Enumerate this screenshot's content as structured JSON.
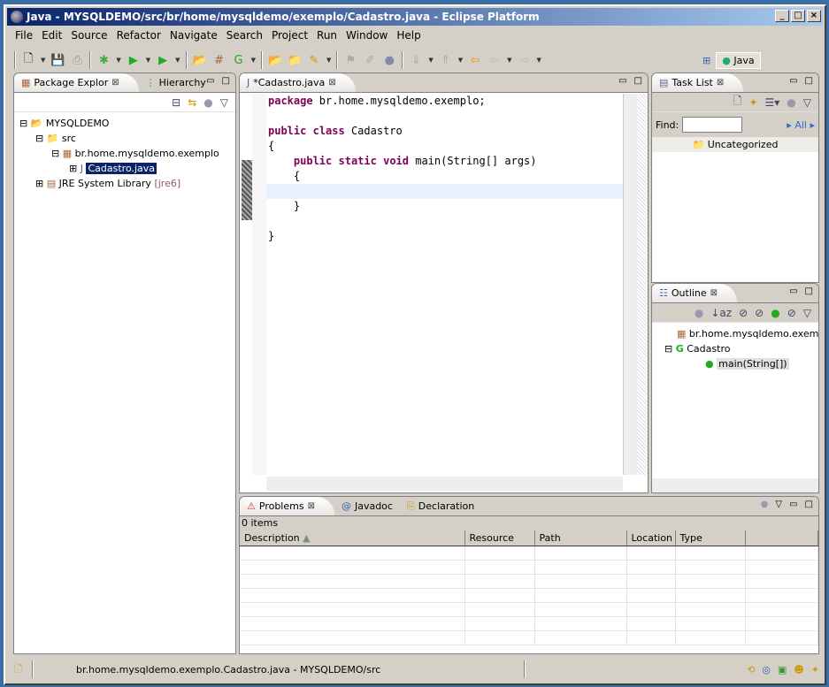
{
  "window": {
    "title": "Java - MYSQLDEMO/src/br/home/mysqldemo/exemplo/Cadastro.java - Eclipse Platform"
  },
  "menu": [
    "File",
    "Edit",
    "Source",
    "Refactor",
    "Navigate",
    "Search",
    "Project",
    "Run",
    "Window",
    "Help"
  ],
  "perspective": {
    "label": "Java"
  },
  "package_explorer": {
    "tabs": [
      "Package Explor",
      "Hierarchy"
    ],
    "tree": {
      "project": "MYSQLDEMO",
      "src": "src",
      "package": "br.home.mysqldemo.exemplo",
      "file": "Cadastro.java",
      "jre": "JRE System Library",
      "jre_version": "[jre6]"
    }
  },
  "editor": {
    "tab": "*Cadastro.java",
    "lines": [
      [
        [
          "kw",
          "package"
        ],
        [
          "t",
          " br.home.mysqldemo.exemplo;"
        ]
      ],
      [],
      [
        [
          "kw",
          "public"
        ],
        [
          "t",
          " "
        ],
        [
          "kw",
          "class"
        ],
        [
          "t",
          " Cadastro"
        ]
      ],
      [
        [
          "t",
          "{"
        ]
      ],
      [
        [
          "t",
          "    "
        ],
        [
          "kw",
          "public"
        ],
        [
          "t",
          " "
        ],
        [
          "kw",
          "static"
        ],
        [
          "t",
          " "
        ],
        [
          "kw",
          "void"
        ],
        [
          "t",
          " main(String[] args)"
        ]
      ],
      [
        [
          "t",
          "    {"
        ]
      ],
      [],
      [
        [
          "t",
          "    }"
        ]
      ],
      [],
      [
        [
          "t",
          "}"
        ]
      ]
    ]
  },
  "task_list": {
    "tab": "Task List",
    "find_label": "Find:",
    "find_value": "",
    "all_label": "All",
    "category": "Uncategorized"
  },
  "outline": {
    "tab": "Outline",
    "items": [
      "br.home.mysqldemo.exemplo",
      "Cadastro",
      "main(String[])"
    ]
  },
  "problems": {
    "tabs": [
      "Problems",
      "Javadoc",
      "Declaration"
    ],
    "count": "0 items",
    "columns": [
      "Description",
      "Resource",
      "Path",
      "Location",
      "Type"
    ]
  },
  "status": {
    "text": "br.home.mysqldemo.exemplo.Cadastro.java - MYSQLDEMO/src"
  }
}
